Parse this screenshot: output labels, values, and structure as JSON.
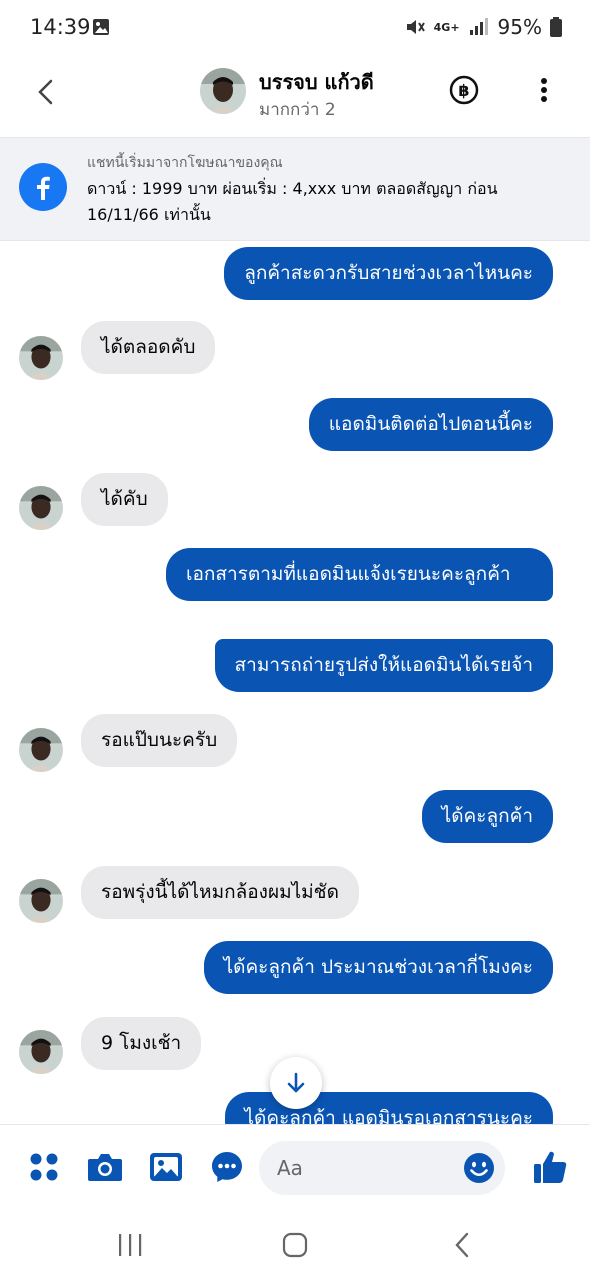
{
  "status_bar": {
    "time": "14:39",
    "network": "4G+",
    "battery": "95%"
  },
  "header": {
    "contact_name": "บรรจบ แก้วดี",
    "subtitle": "มากกว่า 2"
  },
  "ad_banner": {
    "caption": "แชทนี้เริ่มมาจากโฆษณาของคุณ",
    "text": "ดาวน์ : 1999 บาท ผ่อนเริ่ม : 4,xxx บาท ตลอดสัญญา ก่อน 16/11/66 เท่านั้น"
  },
  "messages": [
    {
      "dir": "out",
      "text": "ลูกค้าสะดวกรับสายช่วงเวลาไหนคะ"
    },
    {
      "dir": "in",
      "text": "ได้ตลอดคับ"
    },
    {
      "dir": "out",
      "text": "แอดมินติดต่อไปตอนนี้คะ"
    },
    {
      "dir": "in",
      "text": "ได้คับ"
    },
    {
      "dir": "out",
      "text": "เอกสารตามที่แอดมินแจ้งเรยนะคะลูกค้า"
    },
    {
      "dir": "out",
      "text": "สามารถถ่ายรูปส่งให้แอดมินได้เรยจ้า"
    },
    {
      "dir": "in",
      "text": "รอแป๊บนะครับ"
    },
    {
      "dir": "out",
      "text": "ได้คะลูกค้า"
    },
    {
      "dir": "in",
      "text": "รอพรุ่งนี้ได้ไหมกล้องผมไม่ชัด"
    },
    {
      "dir": "out",
      "text": "ได้คะลูกค้า ประมาณช่วงเวลากี่โมงคะ"
    },
    {
      "dir": "in",
      "text": "9 โมงเช้า"
    },
    {
      "dir": "out",
      "text": "ได้คะลูกค้า แอดมินรอเอกสารนะคะ"
    }
  ],
  "composer": {
    "placeholder": "Aa"
  },
  "colors": {
    "accent": "#0a55b4",
    "brand": "#1877f2",
    "incoming_bubble": "#e9e9eb"
  },
  "icons": [
    "menu-icon",
    "camera-icon",
    "gallery-icon",
    "voice-message-icon",
    "emoji-icon",
    "like-icon"
  ]
}
